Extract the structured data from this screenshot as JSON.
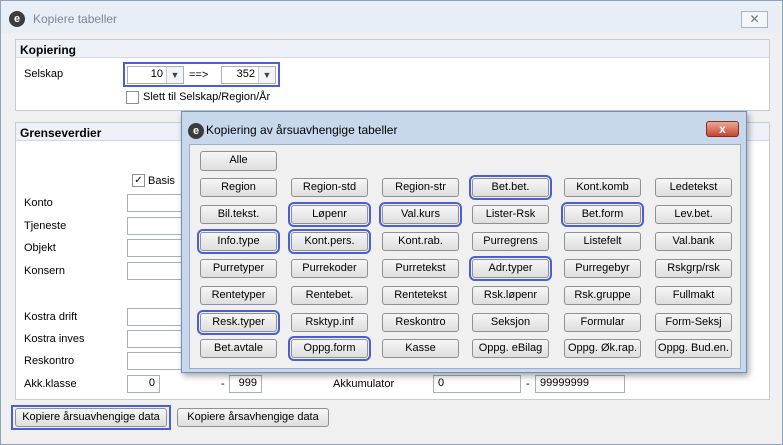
{
  "window": {
    "title": "Kopiere tabeller",
    "close_label": "✕"
  },
  "kopiering": {
    "header": "Kopiering",
    "selskap_label": "Selskap",
    "from_value": "10",
    "arrow": "==>",
    "to_value": "352",
    "slett_label": "Slett til Selskap/Region/År"
  },
  "grense": {
    "header": "Grenseverdier",
    "basis_label": "Basis",
    "basis_checked": "✓",
    "rows": [
      "Konto",
      "Tjeneste",
      "Objekt",
      "Konsern",
      "Kostra drift",
      "Kostra inves",
      "Reskontro"
    ],
    "akk_label": "Akk.klasse",
    "akk_from": "0",
    "dash": "-",
    "akk_to": "999",
    "akkumulator_label": "Akkumulator",
    "akkumulator_from": "0",
    "akkumulator_to": "99999999"
  },
  "buttons": {
    "kopiere_arsu": "Kopiere årsuavhengige data",
    "kopiere_arsa": "Kopiere årsavhengige data"
  },
  "dialog": {
    "title": "Kopiering av årsuavhengige tabeller",
    "close_label": "x",
    "alle": "Alle",
    "grid": [
      [
        "Region",
        "Region-std",
        "Region-str",
        "Bet.bet.",
        "Kont.komb",
        "Ledetekst"
      ],
      [
        "Bil.tekst.",
        "Løpenr",
        "Val.kurs",
        "Lister-Rsk",
        "Bet.form",
        "Lev.bet."
      ],
      [
        "Info.type",
        "Kont.pers.",
        "Kont.rab.",
        "Purregrens",
        "Listefelt",
        "Val.bank"
      ],
      [
        "Purretyper",
        "Purrekoder",
        "Purretekst",
        "Adr.typer",
        "Purregebyr",
        "Rskgrp/rsk"
      ],
      [
        "Rentetyper",
        "Rentebet.",
        "Rentetekst",
        "Rsk.løpenr",
        "Rsk.gruppe",
        "Fullmakt"
      ],
      [
        "Resk.typer",
        "Rsktyp.inf",
        "Reskontro",
        "Seksjon",
        "Formular",
        "Form-Seksj"
      ],
      [
        "Bet.avtale",
        "Oppg.form",
        "Kasse",
        "Oppg. eBilag",
        "Oppg. Øk.rap.",
        "Oppg. Bud.en."
      ]
    ],
    "highlighted": [
      "Bet.bet.",
      "Løpenr",
      "Val.kurs",
      "Bet.form",
      "Info.type",
      "Kont.pers.",
      "Adr.typer",
      "Resk.typer",
      "Oppg.form"
    ]
  }
}
